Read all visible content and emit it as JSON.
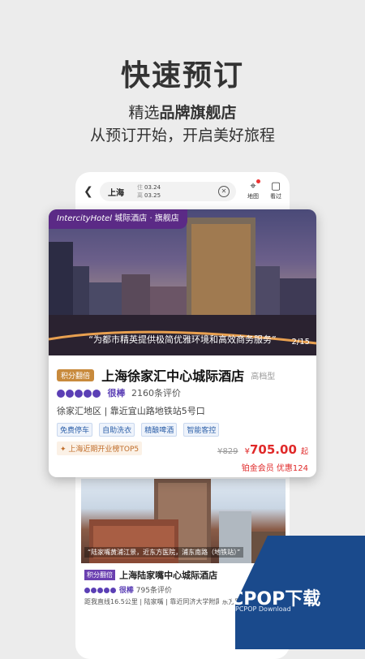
{
  "promo": {
    "headline": "快速预订",
    "sub_prefix": "精选",
    "sub_bold": "品牌旗舰店",
    "sub_line2": "从预订开始，开启美好旅程"
  },
  "topbar": {
    "city": "上海",
    "checkin_key": "住",
    "checkin": "03.24",
    "checkout_key": "离",
    "checkout": "03.25",
    "map_label": "地图",
    "view_label": "看过"
  },
  "hotel1": {
    "badge_brand": "IntercityHotel",
    "badge_rest": "城际酒店 · 旗舰店",
    "photo_caption": "“为都市精英提供极简优雅环境和高效商务服务”",
    "pager": "2/15",
    "points_tag": "积分翻倍",
    "name": "上海徐家汇中心城际酒店",
    "type": "高档型",
    "rating_label": "很棒",
    "review_count": "2160条评价",
    "location": "徐家汇地区 | 靠近宜山路地铁站5号口",
    "amenities": [
      "免费停车",
      "自助洗衣",
      "精酿啤酒",
      "智能客控"
    ],
    "rank": "上海近期开业榜TOP5",
    "orig_price": "¥829",
    "currency": "¥",
    "price": "705.00",
    "price_suffix": "起",
    "member": "铂金会员  优惠124"
  },
  "hotel2": {
    "photo_caption": "“陆家嘴黄浦江景，近东方医院，浦东南路（地铁站）”",
    "points_tag": "积分翻倍",
    "name": "上海陆家嘴中心城际酒店",
    "rating_label": "很棒",
    "review_count": "795条评价",
    "location": "距我直线16.5公里 | 陆家嘴 | 靠近同济大学附属东方医院"
  },
  "watermark": {
    "text": "PCPOP下载",
    "sub": "PCPOP Download"
  },
  "colors": {
    "brand_purple": "#5b2a86",
    "rating_purple": "#5b3fb5",
    "price_red": "#e02a2a",
    "points_gold": "#c88a3c"
  }
}
